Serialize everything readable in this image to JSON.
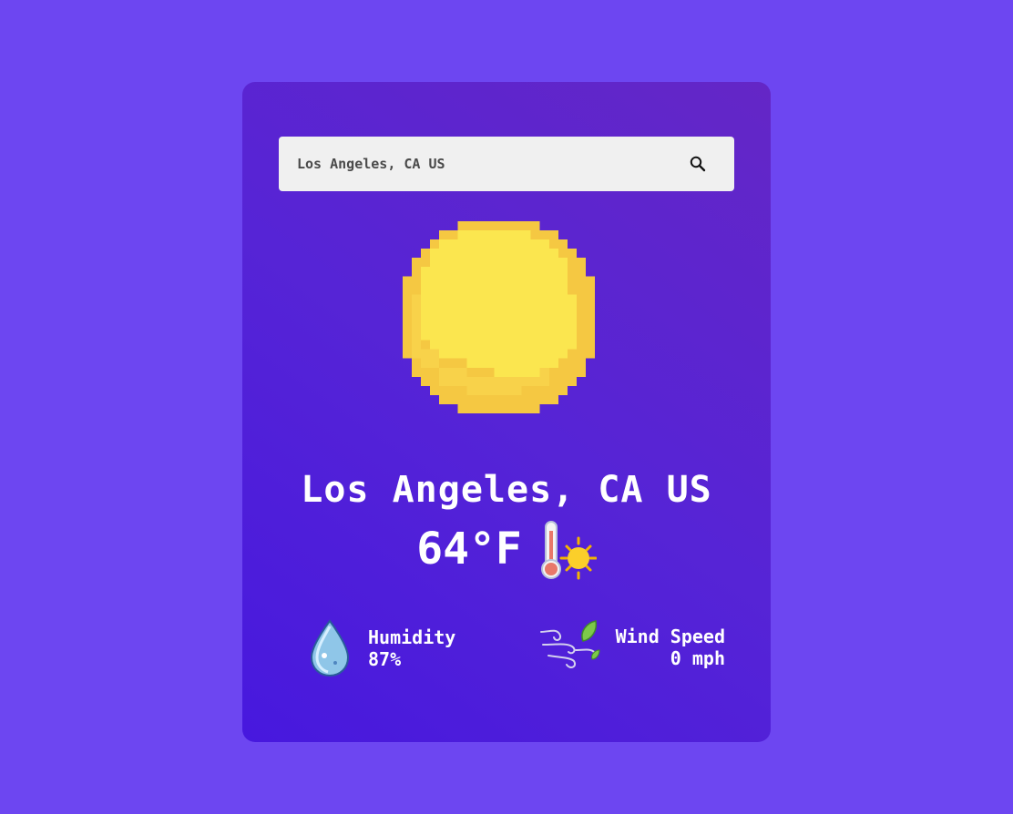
{
  "search": {
    "value": "Los Angeles, CA US",
    "placeholder": "Los Angeles, CA US"
  },
  "weather": {
    "icon": "sun-icon",
    "city": "Los Angeles, CA US",
    "temperature": "64°F",
    "temp_icon": "thermometer-sun-icon"
  },
  "details": {
    "humidity": {
      "label": "Humidity",
      "value": "87%",
      "icon": "water-drop-icon"
    },
    "wind": {
      "label": "Wind Speed",
      "value": "0 mph",
      "icon": "wind-icon"
    }
  },
  "colors": {
    "page_background": "#6d46f1",
    "card_gradient_start": "#4718de",
    "card_gradient_end": "#6426c6",
    "sun_yellow": "#fbe64f",
    "sun_shade": "#f5c842"
  }
}
